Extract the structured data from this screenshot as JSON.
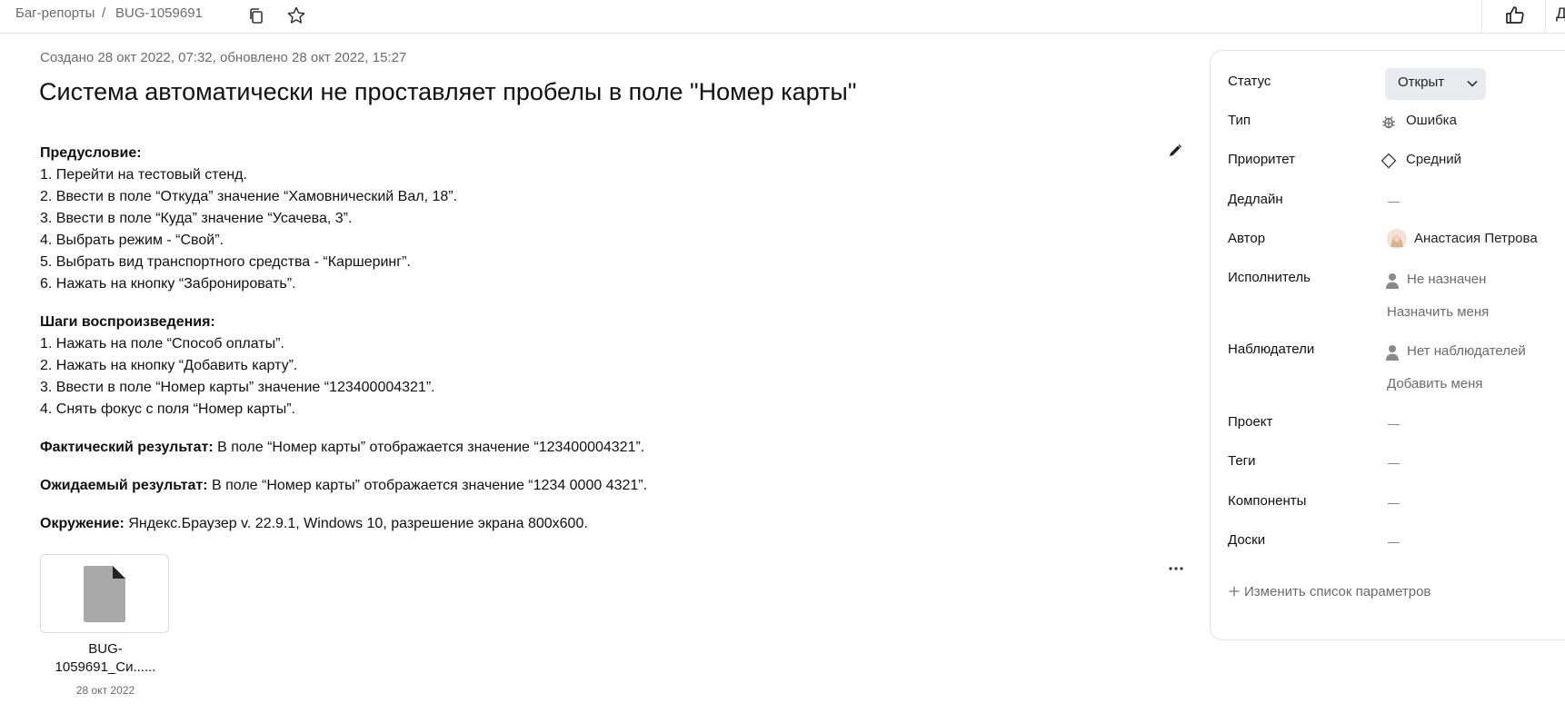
{
  "breadcrumb": {
    "section": "Баг-репорты",
    "separator": "/",
    "issue_key": "BUG-1059691"
  },
  "header": {
    "right_cut_text": "Д"
  },
  "meta": {
    "created_text": "Создано 28 окт 2022, 07:32, обновлено 28 окт 2022, 15:27"
  },
  "title": "Система автоматически не проставляет пробелы в поле \"Номер карты\"",
  "description": {
    "precondition": {
      "heading": "Предусловие:",
      "lines": [
        "1. Перейти на тестовый стенд.",
        "2. Ввести в поле “Откуда” значение “Хамовнический Вал, 18”.",
        "3. Ввести в поле “Куда” значение “Усачева, 3”.",
        "4. Выбрать режим - “Свой”.",
        "5. Выбрать вид транспортного средства - “Каршеринг”.",
        "6. Нажать на кнопку “Забронировать”."
      ]
    },
    "steps": {
      "heading": "Шаги воспроизведения:",
      "lines": [
        "1. Нажать на поле “Способ оплаты”.",
        "2. Нажать на кнопку “Добавить карту”.",
        "3. Ввести в поле “Номер карты” значение “123400004321”.",
        "4. Снять фокус с поля “Номер карты”."
      ]
    },
    "actual": {
      "label": "Фактический результат:",
      "text": " В поле “Номер карты” отображается значение “123400004321”."
    },
    "expected": {
      "label": "Ожидаемый результат:",
      "text": " В поле “Номер карты” отображается значение “1234 0000 4321”."
    },
    "environment": {
      "label": "Окружение:",
      "text": " Яндекс.Браузер v. 22.9.1, Windows 10, разрешение экрана 800x600."
    }
  },
  "attachment": {
    "name_line1": "BUG-",
    "name_line2": "1059691_Си......",
    "date": "28 окт 2022"
  },
  "sidebar": {
    "status": {
      "label": "Статус",
      "value": "Открыт"
    },
    "type": {
      "label": "Тип",
      "value": "Ошибка",
      "icon": "bug-icon"
    },
    "priority": {
      "label": "Приоритет",
      "value": "Средний",
      "icon": "diamond-icon"
    },
    "deadline": {
      "label": "Дедлайн"
    },
    "author": {
      "label": "Автор",
      "value": "Анастасия Петрова"
    },
    "assignee": {
      "label": "Исполнитель",
      "value": "Не назначен",
      "action": "Назначить меня"
    },
    "watchers": {
      "label": "Наблюдатели",
      "value": "Нет наблюдателей",
      "action": "Добавить меня"
    },
    "project": {
      "label": "Проект"
    },
    "tags": {
      "label": "Теги"
    },
    "components": {
      "label": "Компоненты"
    },
    "boards": {
      "label": "Доски"
    },
    "change_params": "Изменить список параметров"
  },
  "colors": {
    "text": "#111111",
    "muted": "#6b6b6b",
    "status_bg": "#e8ecf1",
    "border": "#e3e3e3"
  }
}
